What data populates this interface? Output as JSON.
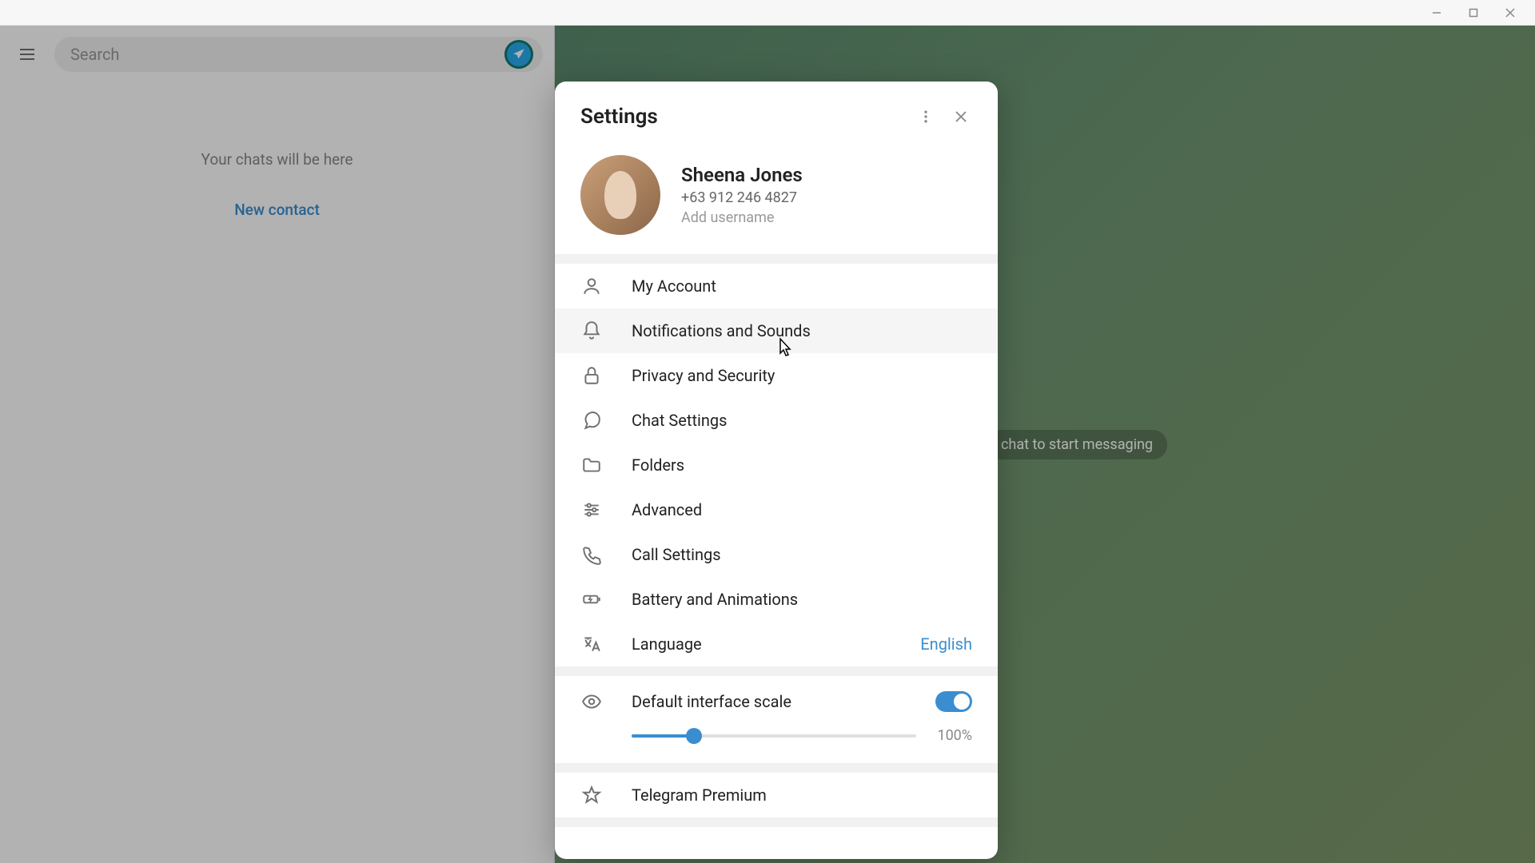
{
  "titlebar": {},
  "leftPanel": {
    "searchPlaceholder": "Search",
    "chatsHint": "Your chats will be here",
    "newContact": "New contact"
  },
  "rightPanel": {
    "startMessaging": "chat to start messaging"
  },
  "modal": {
    "title": "Settings",
    "profile": {
      "name": "Sheena Jones",
      "phone": "+63 912 246 4827",
      "addUsername": "Add username"
    },
    "menu": {
      "myAccount": "My Account",
      "notifications": "Notifications and Sounds",
      "privacy": "Privacy and Security",
      "chatSettings": "Chat Settings",
      "folders": "Folders",
      "advanced": "Advanced",
      "callSettings": "Call Settings",
      "battery": "Battery and Animations",
      "language": "Language",
      "languageValue": "English"
    },
    "scale": {
      "label": "Default interface scale",
      "value": "100%"
    },
    "premium": "Telegram Premium"
  }
}
